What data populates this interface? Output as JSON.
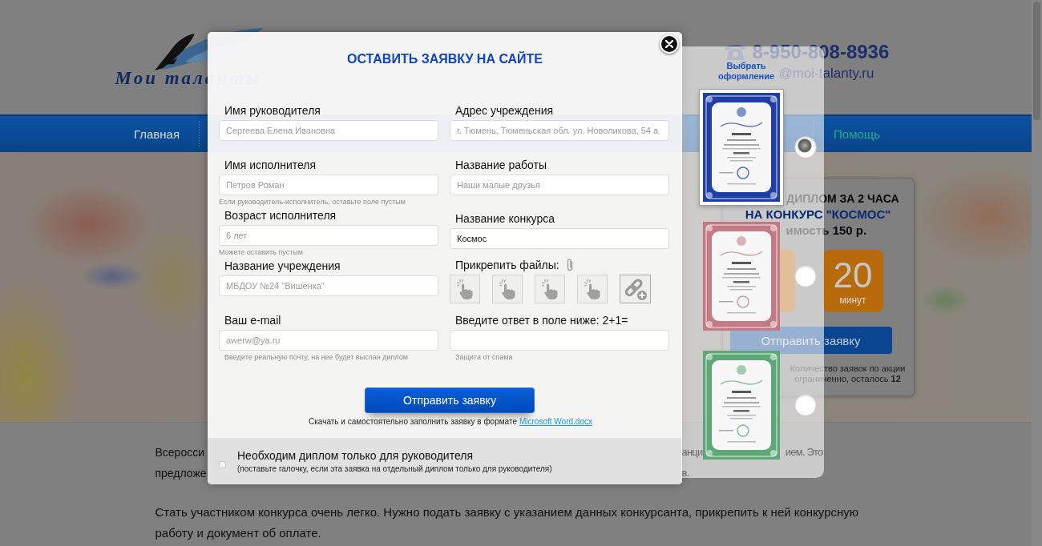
{
  "header": {
    "logo_text": "Мои таланты",
    "phone": "8-950-808-8936",
    "email": "@moi-talanty.ru"
  },
  "nav": [
    {
      "label": "Главная",
      "selected": false
    },
    {
      "label": "Помощь",
      "selected": true
    }
  ],
  "promo": {
    "headline": "ДИПЛОМ ЗА 2 ЧАСА",
    "contest": "НА КОНКУРС \"КОСМОС\"",
    "price": "имость 150 р.",
    "timer": [
      {
        "kind": "blank"
      },
      {
        "kind": "count",
        "number": "20",
        "unit": "минут"
      }
    ],
    "button": "Отправить заявку",
    "notice": "Количество заявок по акции ограниченно, осталось **12**"
  },
  "content": {
    "lines": [
      {
        "segments": [
          "Всеросси",
          "анци",
          "ием. Это"
        ]
      },
      {
        "segments": [
          "предложе",
          "в."
        ]
      }
    ],
    "paragraph": "Стать участником конкурса очень легко. Нужно подать заявку с указанием данных конкурсанта, прикрепить к ней конкурсную работу и документ об оплате."
  },
  "modal": {
    "title": "ОСТАВИТЬ ЗАЯВКУ НА САЙТЕ",
    "left_fields": [
      {
        "kind": "input",
        "label": "Имя руководителя",
        "placeholder": "Сергеева Елена Ивановна"
      },
      {
        "kind": "input",
        "label": "Имя исполнителя",
        "placeholder": "Петров Роман",
        "hint": "Если руководитель-исполнитель, оставьте поле пустым"
      },
      {
        "kind": "input",
        "label": "Возраст исполнителя",
        "placeholder": "6 лет",
        "hint": "Можете оставить пустым"
      },
      {
        "kind": "input",
        "label": "Название учреждения",
        "placeholder": "МБДОУ №24 \"Вишенка\""
      },
      {
        "kind": "input",
        "label": "Ваш e-mail",
        "placeholder": "awerw@ya.ru",
        "hint": "Введите реальную почту, на нее будет выслан диплом"
      }
    ],
    "right_fields": [
      {
        "kind": "input",
        "label": "Адрес учреждения",
        "placeholder": "г. Тюмень, Тюменьская обл. ул. Новоликова, 54 а"
      },
      {
        "kind": "input",
        "label": "Название работы",
        "placeholder": "Наши малые друзья"
      },
      {
        "kind": "input",
        "label": "Название конкурса",
        "value": "Космос"
      },
      {
        "kind": "files",
        "label": "Прикрепить файлы:",
        "slots": [
          {
            "kind": "upload"
          },
          {
            "kind": "upload"
          },
          {
            "kind": "upload"
          },
          {
            "kind": "upload"
          },
          {
            "kind": "link"
          }
        ]
      },
      {
        "kind": "input",
        "label": "Введите ответ в поле ниже: 2+1=",
        "hint": "Защита от спама"
      }
    ],
    "submit": "Отправить заявку",
    "download_note": {
      "text": "Скачать и самостоятельно заполнить заявку в формате",
      "link": "Microsoft Word.docx"
    },
    "leader_only": {
      "checked": false,
      "label": "Необходим диплом только для руководителя",
      "note": "(поставьте галочку, если эта заявка на отдельный диплом только для руководителя)"
    }
  },
  "designs": {
    "title": "Выбрать оформление",
    "items": [
      {
        "color": "#1f3fa6",
        "selected": true
      },
      {
        "color": "#c47a84",
        "selected": false
      },
      {
        "color": "#5ea877",
        "selected": false
      }
    ]
  }
}
